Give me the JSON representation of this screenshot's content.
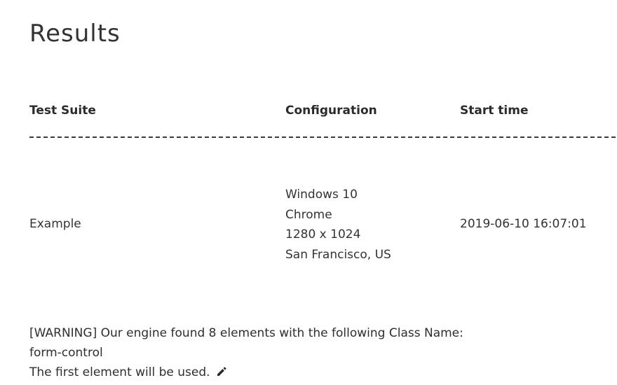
{
  "page": {
    "title": "Results"
  },
  "table": {
    "headers": {
      "test_suite": "Test Suite",
      "configuration": "Configuration",
      "start_time": "Start time"
    },
    "rows": [
      {
        "test_suite": "Example",
        "configuration": {
          "os": "Windows 10",
          "browser": "Chrome",
          "resolution": "1280 x 1024",
          "location": "San Francisco, US"
        },
        "start_time": "2019-06-10 16:07:01"
      }
    ]
  },
  "warning": {
    "line1": "[WARNING] Our engine found 8 elements with the following Class Name:",
    "line2": "form-control",
    "line3": "The first element will be used.",
    "edit_icon": "pencil-icon"
  }
}
